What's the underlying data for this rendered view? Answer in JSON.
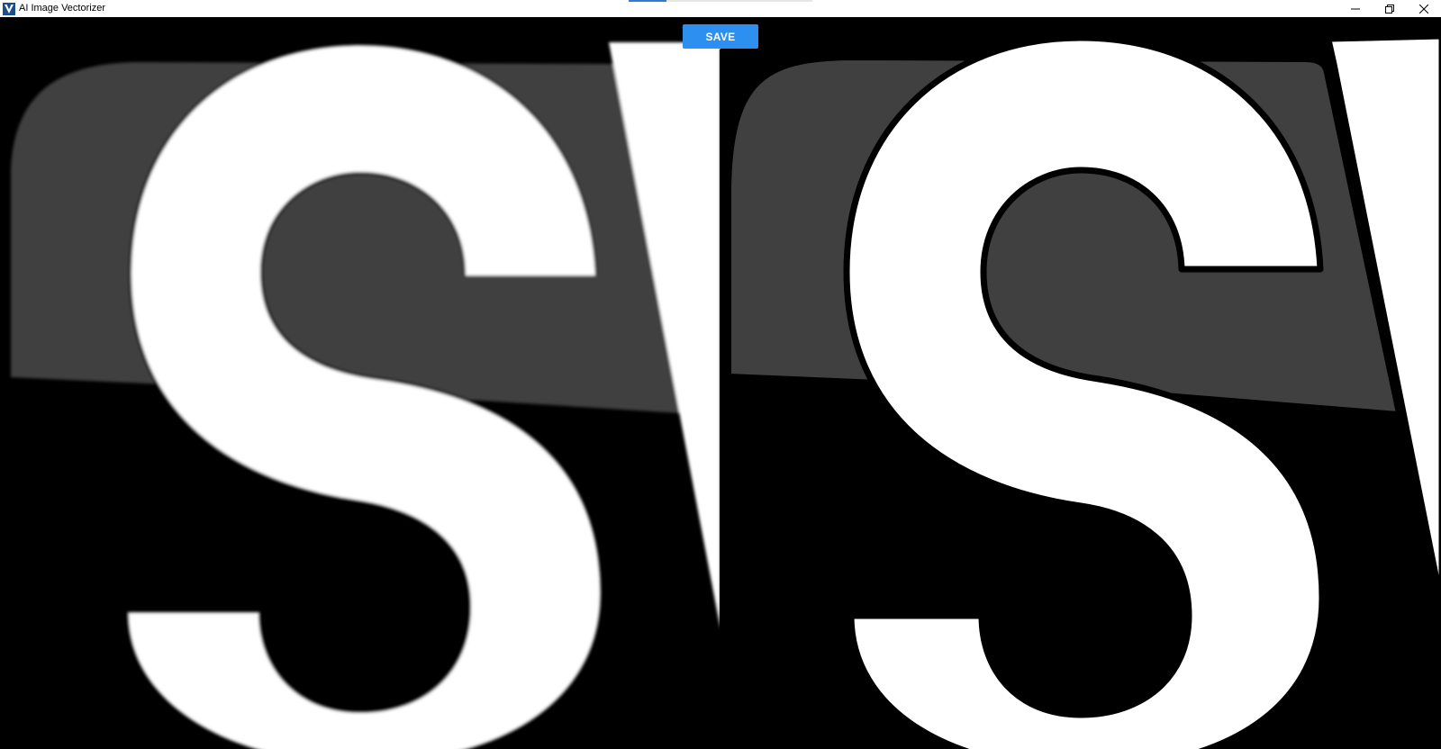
{
  "window": {
    "title": "AI Image Vectorizer",
    "logo_letter": "V",
    "controls": [
      "minimize-icon",
      "restore-icon",
      "close-icon"
    ]
  },
  "toolbar": {
    "save_label": "SAVE"
  },
  "panes": {
    "left": {
      "kind": "original-raster-preview",
      "icon": "image-raster"
    },
    "right": {
      "kind": "vectorized-preview",
      "icon": "image-vector"
    }
  },
  "colors": {
    "accent": "#2d8ff0",
    "logo": "#1c4f8a",
    "canvas_background": "#000000",
    "shape_gray": "#404040",
    "shape_white": "#ffffff"
  }
}
